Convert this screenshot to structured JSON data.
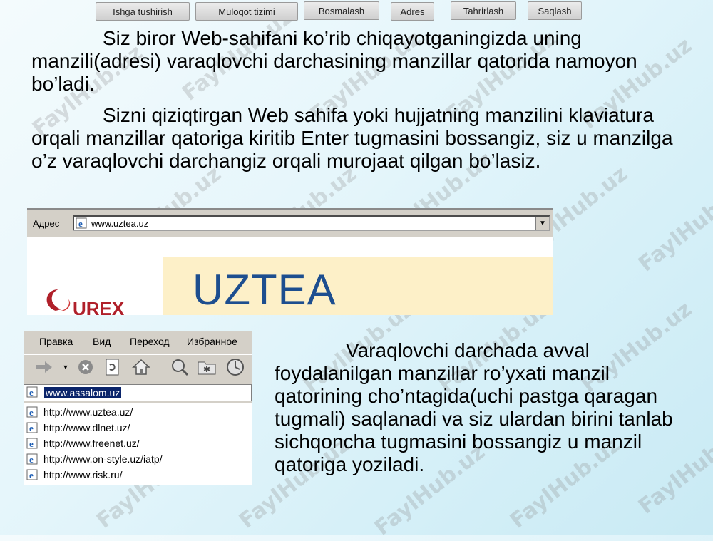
{
  "nav": {
    "buttons": [
      "Ishga tushirish",
      "Muloqot tizimi",
      "Bosmalash",
      "Adres",
      "Tahrirlash",
      "Saqlash"
    ]
  },
  "text": {
    "para1_first": "Siz biror Web-sahifani ko’rib chiqayotganingizda uning",
    "para1_rest": "manzili(adresi) varaqlovchi darchasining manzillar qatorida namoyon bo’ladi.",
    "para2_first": "Sizni qiziqtirgan Web sahifa yoki hujjatning manzilini",
    "para2_rest": "klaviatura orqali manzillar qatoriga kiritib Enter tugmasini bossangiz, siz u manzilga o’z varaqlovchi darchangiz orqali murojaat qilgan bo’lasiz.",
    "para3_first": "Varaqlovchi darchada avval",
    "para3_rest": "foydalanilgan manzillar ro’yxati manzil qatorining cho’ntagida(uchi pastga qaragan tugmali) saqlanadi va siz ulardan birini tanlab sichqoncha tugmasini bossangiz u manzil qatoriga yoziladi."
  },
  "address_screenshot": {
    "label": "Адрес",
    "url": "www.uztea.uz",
    "banner_text": "UZTEA",
    "logo_text": "UREX"
  },
  "browser_screenshot": {
    "menu": [
      "Правка",
      "Вид",
      "Переход",
      "Избранное"
    ],
    "url_value": "www.assalom.uz",
    "history": [
      "http://www.uztea.uz/",
      "http://www.dlnet.uz/",
      "http://www.freenet.uz/",
      "http://www.on-style.uz/iatp/",
      "http://www.risk.ru/"
    ]
  },
  "watermark": "FaylHub.uz",
  "colors": {
    "banner_text": "#1d4e8f",
    "selection": "#0a246a",
    "toolbar_gray": "#d4d0c8"
  }
}
